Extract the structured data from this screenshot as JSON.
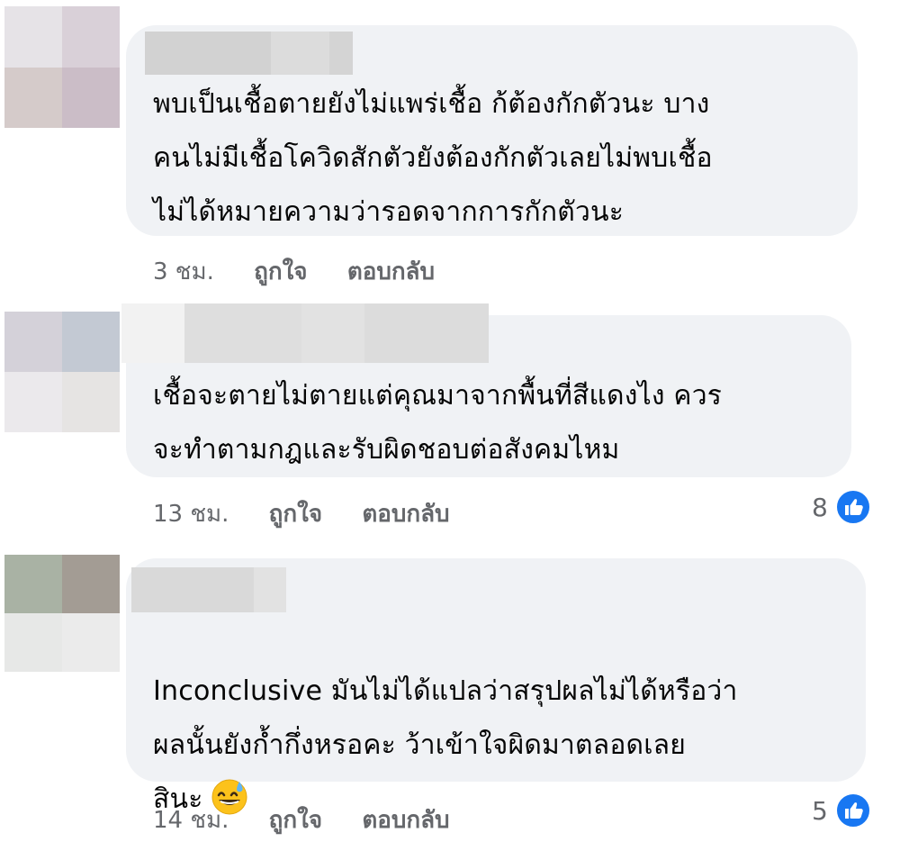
{
  "comments": [
    {
      "text": "พบเป็นเชื้อตายยังไม่แพร่เชื้อ ก้ต้องกักตัวนะ บาง\nคนไม่มีเชื้อโควิดสักตัวยังต้องกักตัวเลยไม่พบเชื้อ\nไม่ได้หมายความว่ารอดจากการกักตัวนะ",
      "time": "3 ชม.",
      "like_label": "ถูกใจ",
      "reply_label": "ตอบกลับ",
      "reaction_count": ""
    },
    {
      "text": "เชื้อจะตายไม่ตายแต่คุณมาจากพื้นที่สีแดงไง ควร\nจะทำตามกฎและรับผิดชอบต่อสังคมไหม",
      "time": "13 ชม.",
      "like_label": "ถูกใจ",
      "reply_label": "ตอบกลับ",
      "reaction_count": "8"
    },
    {
      "text": "Inconclusive มันไม่ได้แปลว่าสรุปผลไม่ได้หรือว่า\nผลนั้นยังก้ำกึ่งหรอคะ ว้าเข้าใจผิดมาตลอดเลย\nสินะ",
      "emoji": "grinning-sweat-emoji",
      "time": "14 ชม.",
      "like_label": "ถูกใจ",
      "reply_label": "ตอบกลับ",
      "reaction_count": "5"
    }
  ],
  "colors": {
    "bubble": "#f0f2f5",
    "meta_text": "#65676b",
    "like_blue": "#1877f2"
  }
}
